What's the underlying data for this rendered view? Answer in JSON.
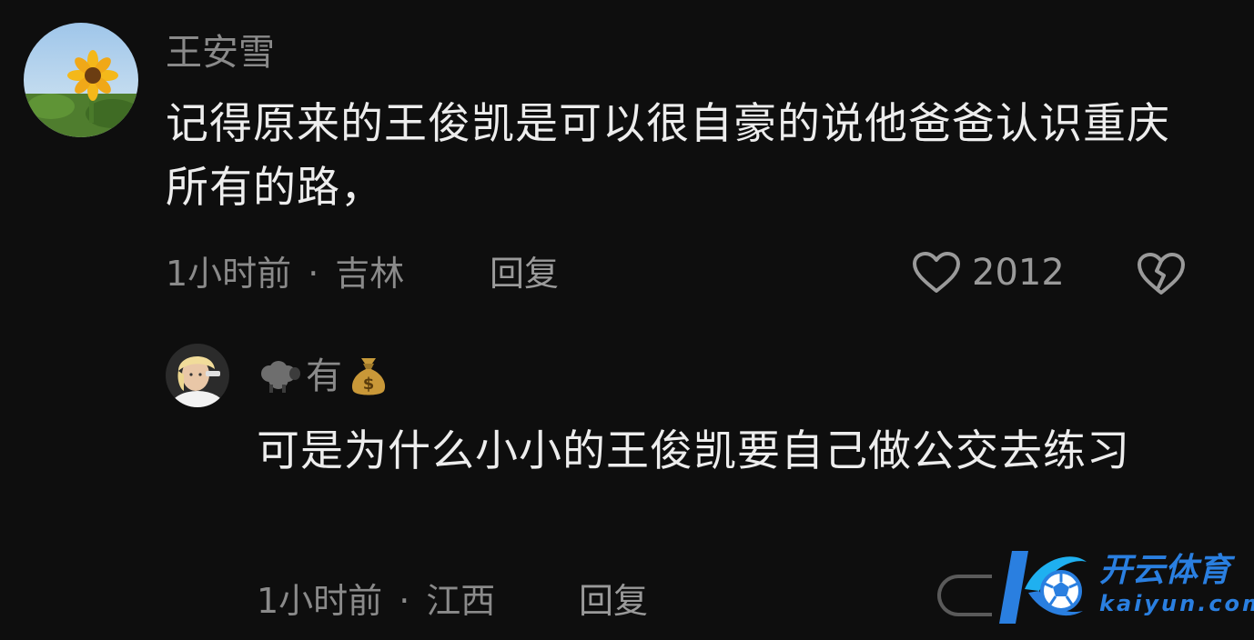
{
  "comment": {
    "username": "王安雪",
    "text": "记得原来的王俊凯是可以很自豪的说他爸爸认识重庆所有的路，",
    "time": "1小时前",
    "separator": "·",
    "location": "吉林",
    "reply_label": "回复",
    "like_count": "2012",
    "icons": {
      "avatar": "sunflower-avatar",
      "like": "heart-outline-icon",
      "dislike": "broken-heart-icon"
    }
  },
  "reply": {
    "username_text": "有",
    "username_prefix_icon": "sheep-emoji",
    "username_suffix_icon": "money-bag-emoji",
    "text": "可是为什么小小的王俊凯要自己做公交去练习",
    "time": "1小时前",
    "separator": "·",
    "location": "江西",
    "reply_label": "回复",
    "icons": {
      "avatar": "blonde-person-avatar"
    }
  },
  "watermark": {
    "brand_cn": "开云体育",
    "brand_en": "kaiyun.com",
    "icon": "kaiyun-k-soccer-logo"
  },
  "colors": {
    "background": "#0e0e0e",
    "primary_text": "#ededed",
    "secondary_text": "#8a8a8a",
    "watermark_blue": "#2a7fe0"
  }
}
